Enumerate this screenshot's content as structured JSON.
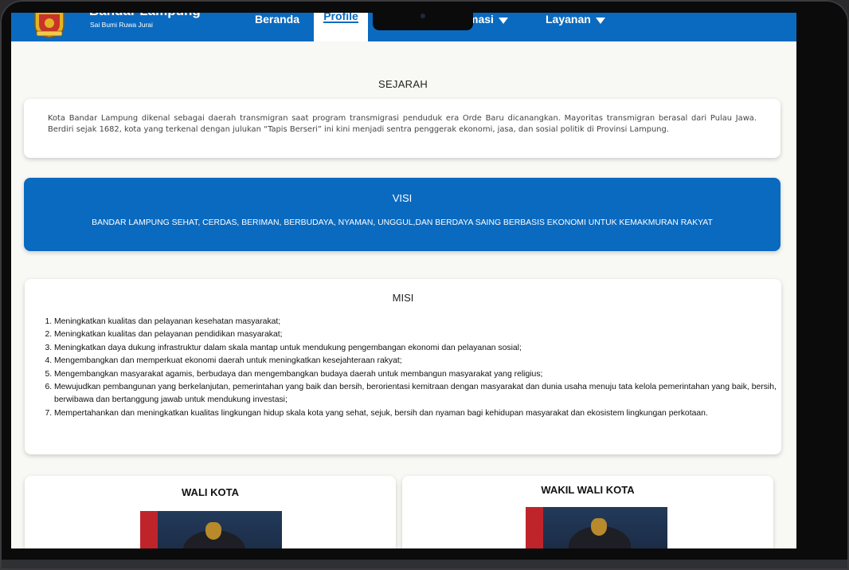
{
  "header": {
    "brand_title": "Bandar Lampung",
    "brand_subtitle": "Sai Bumi Ruwa Jurai",
    "nav": {
      "beranda": "Beranda",
      "profile": "Profile",
      "informasi": "masi",
      "layanan": "Layanan"
    },
    "color": "#0a6ac0"
  },
  "sejarah": {
    "title": "SEJARAH",
    "text": "Kota Bandar Lampung dikenal sebagai daerah transmigran saat program transmigrasi penduduk era Orde Baru dicanangkan. Mayoritas transmigran berasal dari Pulau Jawa. Berdiri sejak 1682, kota yang terkenal dengan julukan “Tapis Berseri” ini kini menjadi sentra penggerak ekonomi, jasa, dan sosial politik di Provinsi Lampung."
  },
  "visi": {
    "title": "VISI",
    "text": "BANDAR LAMPUNG SEHAT, CERDAS, BERIMAN, BERBUDAYA, NYAMAN, UNGGUL,DAN BERDAYA SAING BERBASIS EKONOMI UNTUK KEMAKMURAN RAKYAT"
  },
  "misi": {
    "title": "MISI",
    "items": [
      "Meningkatkan kualitas dan pelayanan kesehatan masyarakat;",
      "Meningkatkan kualitas dan pelayanan pendidikan masyarakat;",
      "Meningkatkan daya dukung infrastruktur dalam skala mantap untuk mendukung pengembangan ekonomi dan pelayanan sosial;",
      "Mengembangkan dan memperkuat ekonomi daerah untuk meningkatkan kesejahteraan rakyat;",
      "Mengembangkan masyarakat agamis, berbudaya dan mengembangkan budaya daerah untuk membangun masyarakat yang religius;",
      "Mewujudkan pembangunan yang berkelanjutan, pemerintahan yang baik dan bersih, berorientasi kemitraan dengan masyarakat dan dunia usaha menuju tata kelola pemerintahan yang baik, bersih, berwibawa dan bertanggung jawab untuk mendukung investasi;",
      "Mempertahankan dan meningkatkan kualitas lingkungan hidup skala kota yang sehat, sejuk, bersih dan nyaman bagi kehidupan masyarakat dan ekosistem lingkungan perkotaan."
    ]
  },
  "officials": {
    "wali_kota": "WALI KOTA",
    "wakil_wali_kota": "WAKIL WALI KOTA"
  }
}
